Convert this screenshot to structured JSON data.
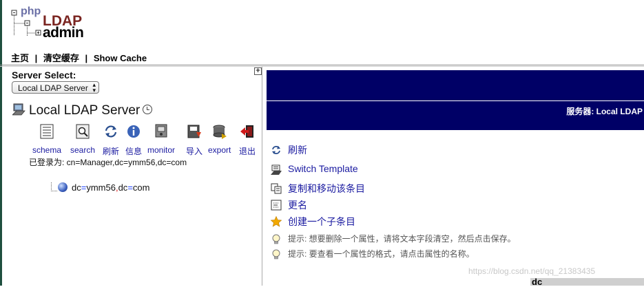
{
  "header": {
    "logo": {
      "php": "php",
      "ldap": "LDAP",
      "admin": "admin"
    },
    "nav": {
      "home": "主页",
      "clear_cache": "清空缓存",
      "show_cache": "Show Cache",
      "separator": "|"
    }
  },
  "sidebar": {
    "server_select_label": "Server Select:",
    "expand_symbol": "+",
    "server_select": {
      "selected": "Local LDAP Server"
    },
    "server_title": "Local LDAP Server",
    "tools": [
      {
        "label": "schema",
        "icon": "schema-icon"
      },
      {
        "label": "search",
        "icon": "search-icon"
      },
      {
        "label": "刷新",
        "icon": "refresh-icon"
      },
      {
        "label": "信息",
        "icon": "info-icon"
      },
      {
        "label": "monitor",
        "icon": "monitor-icon"
      },
      {
        "label": "导入",
        "icon": "import-icon"
      },
      {
        "label": "export",
        "icon": "export-icon"
      },
      {
        "label": "退出",
        "icon": "logout-icon"
      }
    ],
    "logged_in": "已登录为: cn=Manager,dc=ymm56,dc=com",
    "tree_entry": {
      "part1": "dc",
      "eq1": "=",
      "val1": "ymm56",
      "comma": ",",
      "part2": "dc",
      "eq2": "=",
      "val2": "com"
    }
  },
  "main": {
    "banner_server": "服务器: Local LDAP",
    "actions": [
      {
        "label": "刷新",
        "icon": "refresh-icon"
      },
      {
        "label": "Switch Template",
        "icon": "switch-template-icon"
      },
      {
        "label": "复制和移动该条目",
        "icon": "copy-icon"
      },
      {
        "label": "更名",
        "icon": "rename-icon"
      },
      {
        "label": "创建一个子条目",
        "icon": "star-icon"
      }
    ],
    "hints": [
      "提示: 想要删除一个属性，请将文本字段清空，然后点击保存。",
      "提示: 要查看一个属性的格式，请点击属性的名称。"
    ],
    "cut_text": "dc"
  },
  "watermark": "https://blog.csdn.net/qq_21383435",
  "colors": {
    "banner": "#000066",
    "link": "#1a1aa0",
    "attr_eq": "#1a40ff",
    "attr_comma": "#dd1111"
  }
}
